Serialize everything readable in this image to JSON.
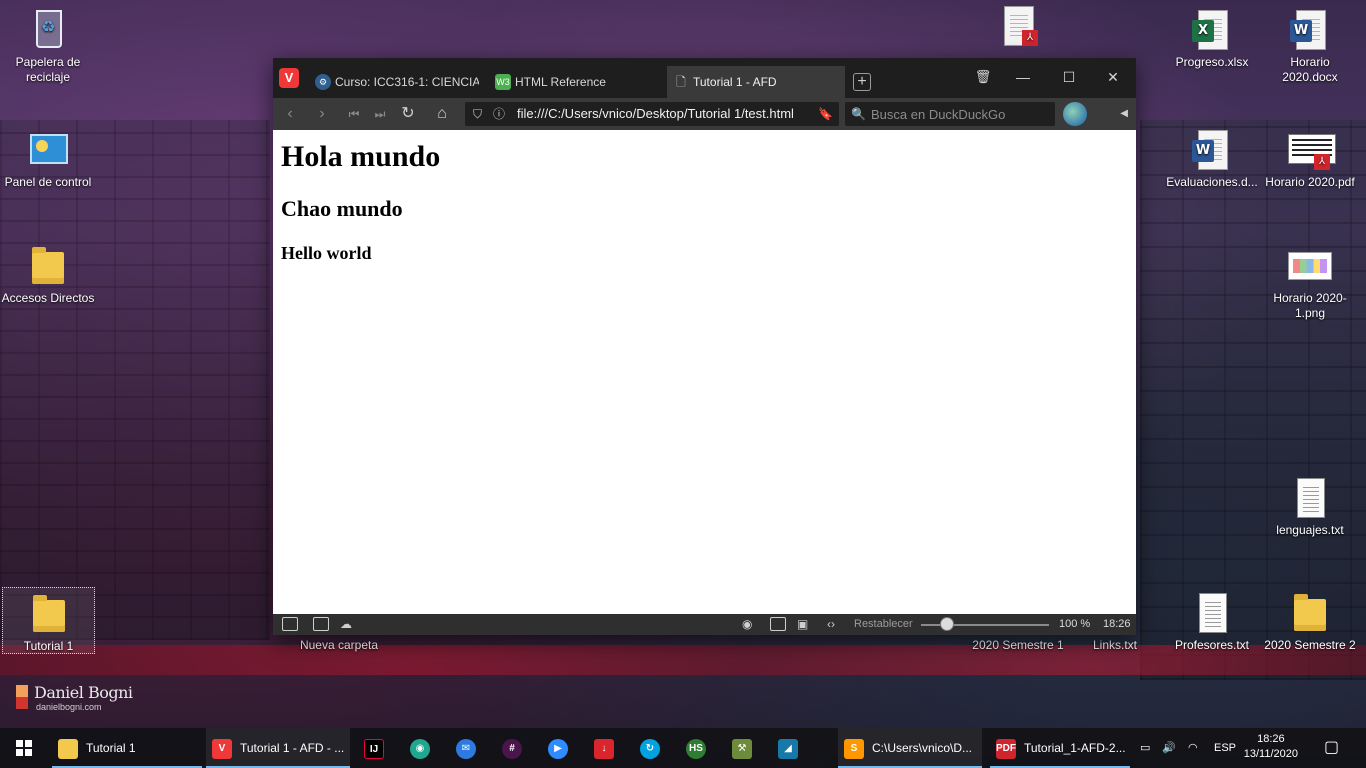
{
  "desktop": {
    "icons_left": [
      {
        "label": "Papelera de reciclaje",
        "icon": "recycle-bin-icon"
      },
      {
        "label": "Panel de control",
        "icon": "control-panel-icon"
      },
      {
        "label": "Accesos Directos",
        "icon": "folder-icon"
      },
      {
        "label": "Tutorial 1",
        "icon": "folder-icon"
      },
      {
        "label": "Nueva carpeta",
        "icon": "folder-icon"
      }
    ],
    "icons_right": [
      {
        "label": "Progreso.xlsx",
        "icon": "excel-file-icon"
      },
      {
        "label": "Horario 2020.docx",
        "icon": "word-file-icon"
      },
      {
        "label": "Evaluaciones.d...",
        "icon": "word-file-icon"
      },
      {
        "label": "Horario 2020.pdf",
        "icon": "pdf-file-icon"
      },
      {
        "label": "Horario 2020-1.png",
        "icon": "image-file-icon"
      },
      {
        "label": "lenguajes.txt",
        "icon": "text-file-icon"
      },
      {
        "label": "2020 Semestre 1",
        "icon": "folder-icon"
      },
      {
        "label": "Links.txt",
        "icon": "text-file-icon"
      },
      {
        "label": "Profesores.txt",
        "icon": "text-file-icon"
      },
      {
        "label": "2020 Semestre 2",
        "icon": "folder-icon"
      }
    ],
    "watermark": {
      "name": "Daniel Bogni",
      "site": "danielbogni.com"
    }
  },
  "browser": {
    "tabs": [
      {
        "label": "Curso: ICC316-1: CIENCIAS",
        "icon": "moodle-icon"
      },
      {
        "label": "HTML Reference",
        "icon": "w3-icon"
      },
      {
        "label": "Tutorial 1 - AFD",
        "icon": "page-icon",
        "active": true
      }
    ],
    "url": "file:///C:/Users/vnico/Desktop/Tutorial 1/test.html",
    "search_placeholder": "Busca en DuckDuckGo",
    "page": {
      "h1": "Hola mundo",
      "h2": "Chao mundo",
      "h3": "Hello world"
    },
    "status": {
      "reset_label": "Restablecer",
      "zoom_level": "100 %",
      "zoom_fraction": 0.2,
      "clock": "18:26"
    }
  },
  "taskbar": {
    "items": [
      {
        "label": "Tutorial 1",
        "icon": "folder-icon"
      },
      {
        "label": "Tutorial 1 - AFD - ...",
        "icon": "vivaldi-icon"
      },
      {
        "label": "C:\\Users\\vnico\\D...",
        "icon": "sublime-text-icon"
      },
      {
        "label": "Tutorial_1-AFD-2...",
        "icon": "pdf-reader-icon"
      }
    ],
    "language": "ESP",
    "time": "18:26",
    "date": "13/11/2020"
  },
  "colors": {
    "accent": "#76b9ed",
    "vivaldi_red": "#ef3939",
    "excel_green": "#1e7145",
    "word_blue": "#2b5797"
  }
}
